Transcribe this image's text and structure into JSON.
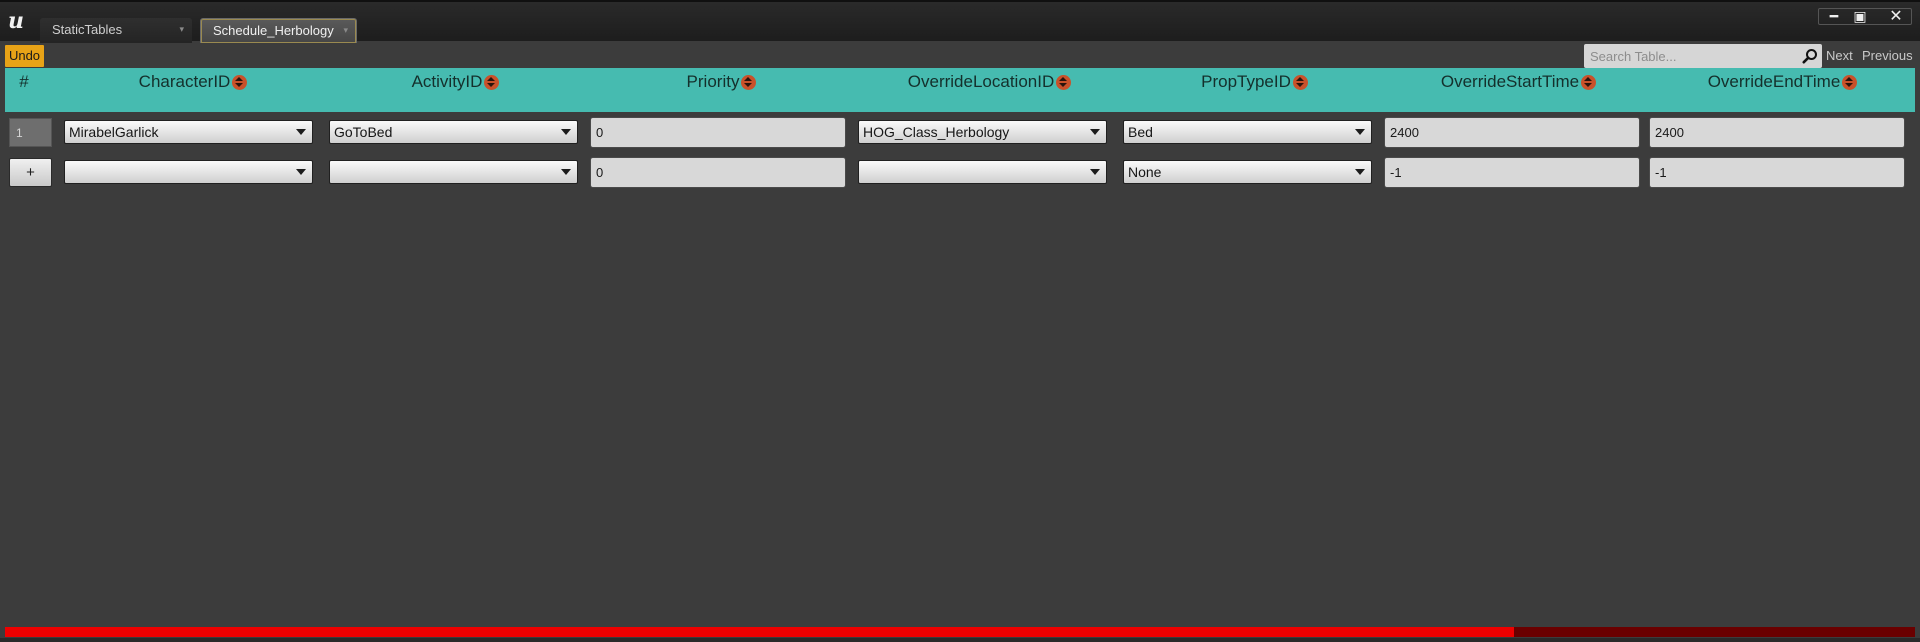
{
  "tabs": [
    {
      "label": "StaticTables",
      "active": false
    },
    {
      "label": "Schedule_Herbology",
      "active": true
    }
  ],
  "window_controls": {
    "minimize": "━",
    "maximize": "▣",
    "close": "✕"
  },
  "toolbar": {
    "undo_label": "Undo",
    "search_placeholder": "Search Table...",
    "next_label": "Next",
    "previous_label": "Previous"
  },
  "table": {
    "columns": [
      "#",
      "CharacterID",
      "ActivityID",
      "Priority",
      "OverrideLocationID",
      "PropTypeID",
      "OverrideStartTime",
      "OverrideEndTime"
    ],
    "rows": [
      {
        "index": "1",
        "CharacterID": "MirabelGarlick",
        "ActivityID": "GoToBed",
        "Priority": "0",
        "OverrideLocationID": "HOG_Class_Herbology",
        "PropTypeID": "Bed",
        "OverrideStartTime": "2400",
        "OverrideEndTime": "2400"
      }
    ],
    "new_row": {
      "add_label": "+",
      "CharacterID": "",
      "ActivityID": "",
      "Priority": "0",
      "OverrideLocationID": "",
      "PropTypeID": "None",
      "OverrideStartTime": "-1",
      "OverrideEndTime": "-1"
    }
  },
  "scrollbar": {
    "horizontal_position_fraction": 0.79
  },
  "colors": {
    "header_bg": "#46bbb0",
    "undo_bg": "#e8a317",
    "sort_icon": "#c9512a",
    "scroll_thumb": "#ee0000",
    "scroll_track": "#6a0000",
    "background": "#3c3c3c"
  },
  "icons": {
    "logo": "unreal-engine-logo",
    "search": "magnifier-icon",
    "sort": "sort-up-down-icon",
    "dropdown": "chevron-down-icon"
  }
}
